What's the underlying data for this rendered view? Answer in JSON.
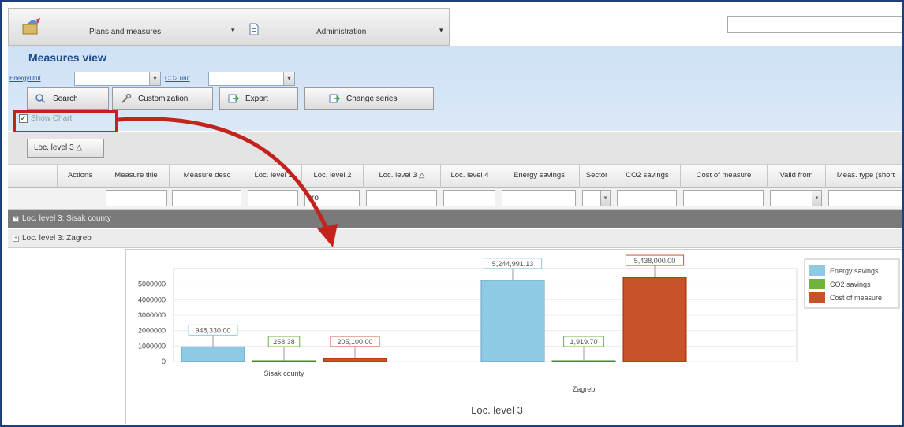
{
  "nav": {
    "plans_label": "Plans and measures",
    "admin_label": "Administration",
    "dropdown_glyph": "▾"
  },
  "measures_view": {
    "title": "Measures view",
    "energy_unit_label": "EnergyUnit",
    "co2_unit_label": "CO2 unit",
    "energy_unit_value": "",
    "co2_unit_value": "",
    "buttons": {
      "search": "Search",
      "customization": "Customization",
      "export": "Export",
      "change_series": "Change series"
    },
    "show_chart_label": "Show Chart",
    "show_chart_checked": true
  },
  "grouping": {
    "chip_label": "Loc. level 3 △"
  },
  "grid": {
    "columns": [
      "",
      "Actions",
      "Measure title",
      "Measure desc",
      "Loc. level 1",
      "Loc. level 2",
      "Loc. level 3 △",
      "Loc. level 4",
      "Energy savings",
      "Sector",
      "CO2 savings",
      "Cost of measure",
      "Valid from",
      "Meas. type (short"
    ],
    "filters": {
      "loc_level_2": "cro"
    },
    "groups": [
      {
        "label": "Loc. level 3: Sisak county",
        "expander": "+"
      },
      {
        "label": "Loc. level 3: Zagreb",
        "expander": "+"
      }
    ]
  },
  "colors": {
    "energy": "#8ec9e6",
    "co2": "#6fb33a",
    "cost": "#c8532a",
    "annotation_red": "#c4231d"
  },
  "chart_data": {
    "type": "bar",
    "categories": [
      "Sisak county",
      "Zagreb"
    ],
    "series": [
      {
        "name": "Energy savings",
        "values": [
          948330.0,
          5244991.13
        ],
        "labels": [
          "948,330.00",
          "5,244,991.13"
        ]
      },
      {
        "name": "CO2 savings",
        "values": [
          258.38,
          1919.7
        ],
        "labels": [
          "258.38",
          "1,919.70"
        ]
      },
      {
        "name": "Cost of measure",
        "values": [
          205100.0,
          5438000.0
        ],
        "labels": [
          "205,100.00",
          "5,438,000.00"
        ]
      }
    ],
    "yticks": [
      "5000000",
      "4000000",
      "3000000",
      "2000000",
      "1000000",
      "0"
    ],
    "ylim": [
      0,
      6000000
    ],
    "xlabel": "Loc. level 3",
    "ylabel": "",
    "legend_position": "right",
    "grid": true
  }
}
